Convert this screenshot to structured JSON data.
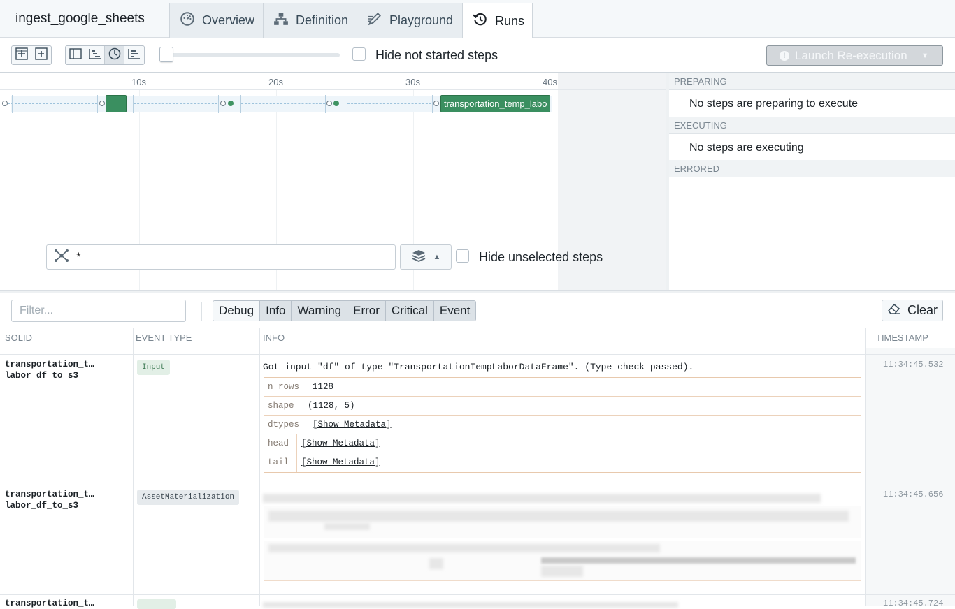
{
  "pipeline": {
    "name": "ingest_google_sheets"
  },
  "tabs": [
    {
      "label": "Overview",
      "icon": "dashboard-icon"
    },
    {
      "label": "Definition",
      "icon": "diagram-tree-icon"
    },
    {
      "label": "Playground",
      "icon": "edit-icon"
    },
    {
      "label": "Runs",
      "icon": "history-icon",
      "active": true
    }
  ],
  "toolbar": {
    "hide_not_started": "Hide not started steps",
    "launch_label": "Launch Re-execution"
  },
  "gantt": {
    "ticks": [
      "10s",
      "20s",
      "30s",
      "40s"
    ],
    "step_label": "transportation_temp_labo",
    "query_value": "*",
    "hide_unselected": "Hide unselected steps"
  },
  "status": {
    "preparing_head": "PREPARING",
    "preparing_msg": "No steps are preparing to execute",
    "executing_head": "EXECUTING",
    "executing_msg": "No steps are executing",
    "errored_head": "ERRORED"
  },
  "logs": {
    "filter_placeholder": "Filter...",
    "levels": [
      "Debug",
      "Info",
      "Warning",
      "Error",
      "Critical",
      "Event"
    ],
    "clear_label": "Clear",
    "columns": {
      "solid": "SOLID",
      "event_type": "EVENT TYPE",
      "info": "INFO",
      "timestamp": "TIMESTAMP"
    },
    "rows": [
      {
        "solid_line1": "transportation_t…",
        "solid_line2": "labor_df_to_s3",
        "event_type": "Input",
        "info": "Got input \"df\" of type \"TransportationTempLaborDataFrame\". (Type check passed).",
        "timestamp": "11:34:45.532",
        "metadata": [
          {
            "key": "n_rows",
            "value": "1128"
          },
          {
            "key": "shape",
            "value": "(1128, 5)"
          },
          {
            "key": "dtypes",
            "value": "[Show Metadata]"
          },
          {
            "key": "head",
            "value": "[Show Metadata]"
          },
          {
            "key": "tail",
            "value": "[Show Metadata]"
          }
        ]
      },
      {
        "solid_line1": "transportation_t…",
        "solid_line2": "labor_df_to_s3",
        "event_type": "AssetMaterialization",
        "timestamp": "11:34:45.656"
      },
      {
        "solid_line1": "transportation_t…",
        "timestamp": "11:34:45.724"
      }
    ]
  }
}
